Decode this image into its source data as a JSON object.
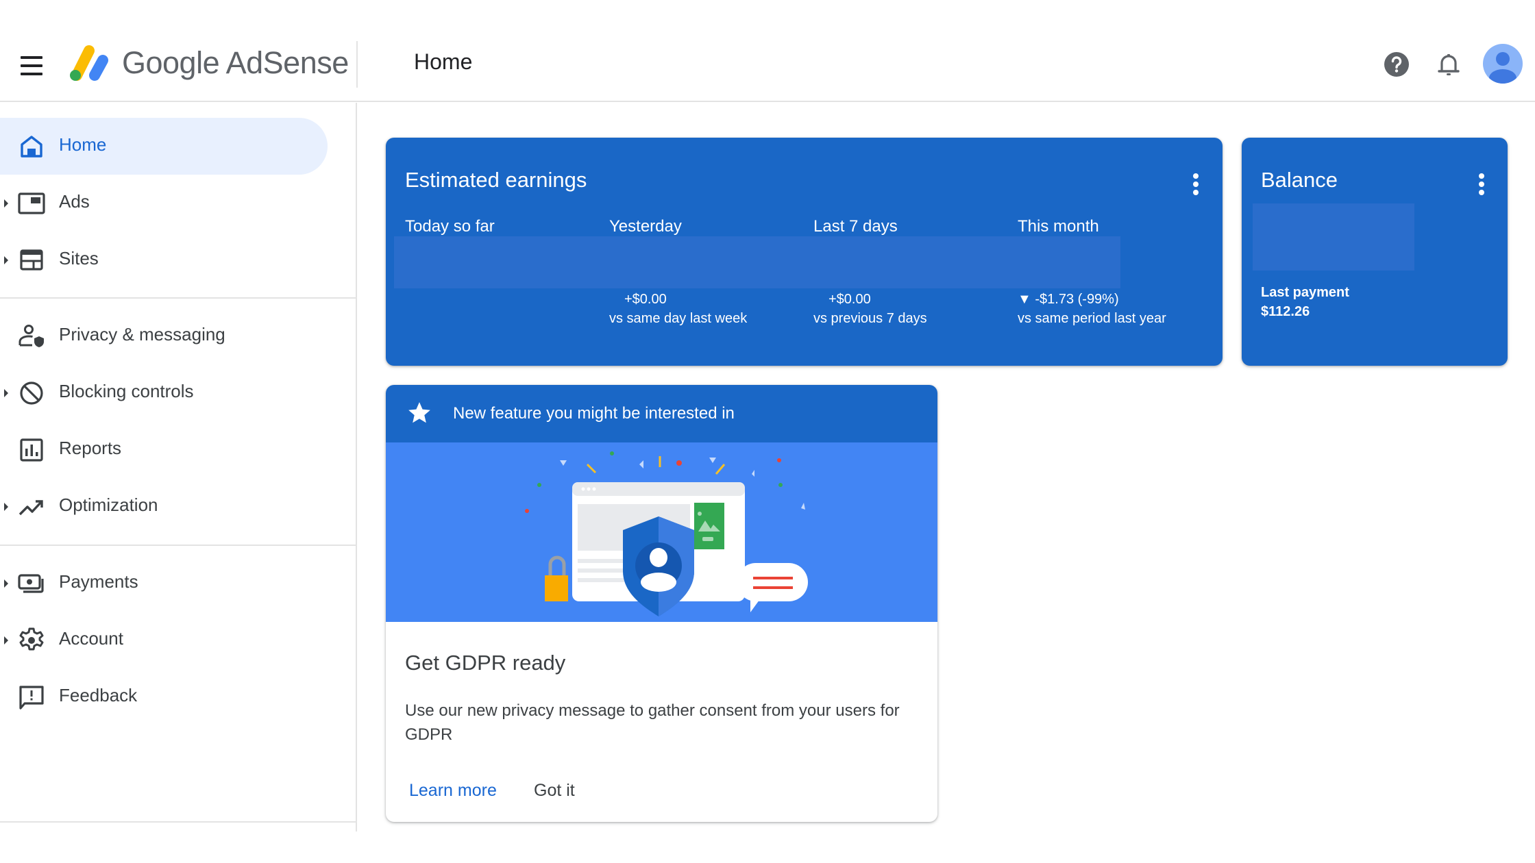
{
  "app": {
    "name": "Google AdSense",
    "page_title": "Home"
  },
  "header": {
    "menu_icon": "hamburger-menu-icon",
    "help_icon": "help-circle-icon",
    "notifications_icon": "bell-icon",
    "avatar_icon": "account-avatar-icon"
  },
  "sidebar": {
    "items": [
      {
        "label": "Home",
        "icon": "home-icon",
        "expandable": false,
        "active": true
      },
      {
        "label": "Ads",
        "icon": "ads-icon",
        "expandable": true,
        "active": false
      },
      {
        "label": "Sites",
        "icon": "sites-icon",
        "expandable": true,
        "active": false
      },
      {
        "label": "Privacy & messaging",
        "icon": "privacy-user-shield-icon",
        "expandable": false,
        "active": false
      },
      {
        "label": "Blocking controls",
        "icon": "block-icon",
        "expandable": true,
        "active": false
      },
      {
        "label": "Reports",
        "icon": "bar-chart-icon",
        "expandable": false,
        "active": false
      },
      {
        "label": "Optimization",
        "icon": "trending-up-icon",
        "expandable": true,
        "active": false
      },
      {
        "label": "Payments",
        "icon": "payments-icon",
        "expandable": true,
        "active": false
      },
      {
        "label": "Account",
        "icon": "gear-icon",
        "expandable": true,
        "active": false
      },
      {
        "label": "Feedback",
        "icon": "feedback-icon",
        "expandable": false,
        "active": false
      }
    ]
  },
  "earnings": {
    "title": "Estimated earnings",
    "columns": [
      {
        "label": "Today so far",
        "change": "",
        "comparison": ""
      },
      {
        "label": "Yesterday",
        "change": "+$0.00",
        "comparison": "vs same day last week"
      },
      {
        "label": "Last 7 days",
        "change": "+$0.00",
        "comparison": "vs previous 7 days"
      },
      {
        "label": "This month",
        "change": "▼ -$1.73 (-99%)",
        "comparison": "vs same period last year"
      }
    ]
  },
  "balance": {
    "title": "Balance",
    "last_payment_label": "Last payment",
    "last_payment_value": "$112.26"
  },
  "feature_card": {
    "header": "New feature you might be interested in",
    "title": "Get GDPR ready",
    "body": "Use our new privacy message to gather consent from your users for GDPR",
    "learn_more": "Learn more",
    "got_it": "Got it"
  },
  "colors": {
    "brand_blue": "#1a67c6",
    "illustration_blue": "#4285f4",
    "active_nav_bg": "#e8f0fe",
    "active_nav_text": "#1967d2",
    "link_blue": "#1967d2"
  }
}
